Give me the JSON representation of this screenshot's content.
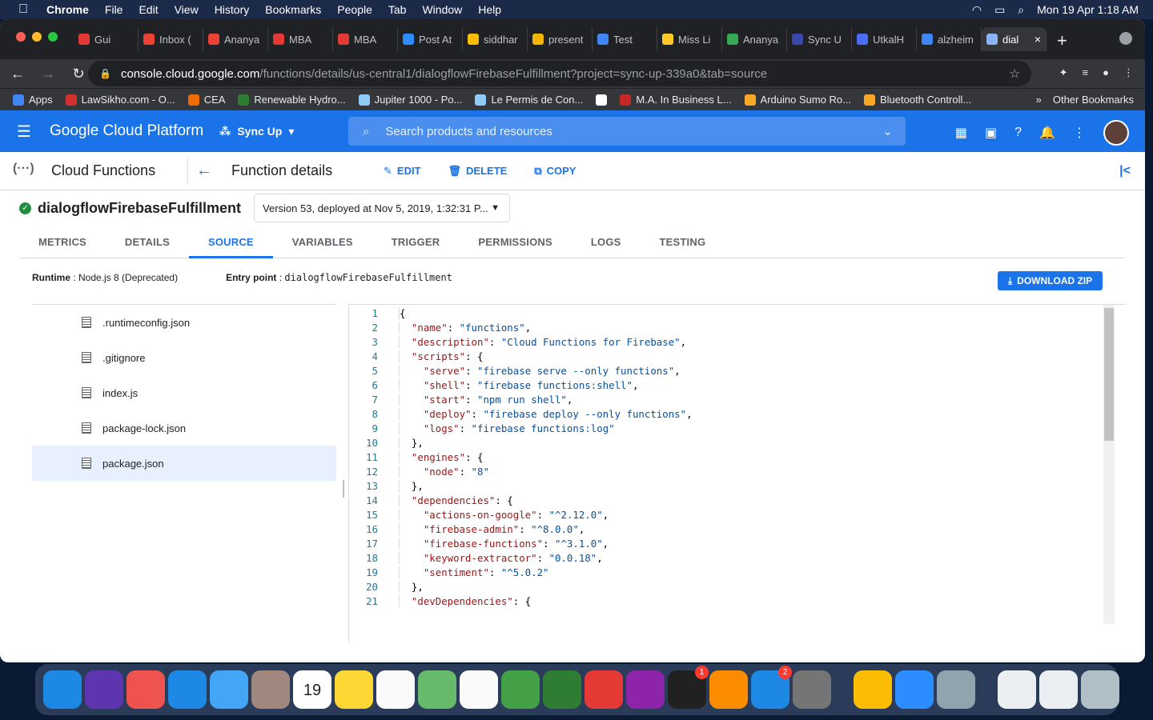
{
  "os": {
    "menubar": [
      "Chrome",
      "File",
      "Edit",
      "View",
      "History",
      "Bookmarks",
      "People",
      "Tab",
      "Window",
      "Help"
    ],
    "clock": "Mon 19 Apr  1:18 AM"
  },
  "browser": {
    "tabs": [
      {
        "label": "Gui",
        "color": "#e53935"
      },
      {
        "label": "Inbox (",
        "color": "#ea4335"
      },
      {
        "label": "Ananya",
        "color": "#ea4335"
      },
      {
        "label": "MBA",
        "color": "#e53935"
      },
      {
        "label": "MBA",
        "color": "#e53935"
      },
      {
        "label": "Post At",
        "color": "#2d8cff"
      },
      {
        "label": "siddhar",
        "color": "#fbbc04"
      },
      {
        "label": "present",
        "color": "#f4b400"
      },
      {
        "label": "Test",
        "color": "#4285f4"
      },
      {
        "label": "Miss Li",
        "color": "#ffca28"
      },
      {
        "label": "Ananya",
        "color": "#34a853"
      },
      {
        "label": "Sync U",
        "color": "#3949ab"
      },
      {
        "label": "UtkalH",
        "color": "#4a6cf7"
      },
      {
        "label": "alzheim",
        "color": "#4285f4"
      },
      {
        "label": "dial",
        "color": "#8ab4f8"
      }
    ],
    "url_host": "console.cloud.google.com",
    "url_path": "/functions/details/us-central1/dialogflowFirebaseFulfillment?project=sync-up-339a0&tab=source",
    "bookmarks": [
      {
        "label": "Apps",
        "color": "#4285f4"
      },
      {
        "label": "LawSikho.com - O...",
        "color": "#d32f2f"
      },
      {
        "label": "CEA",
        "color": "#ef6c00"
      },
      {
        "label": "Renewable Hydro...",
        "color": "#2e7d32"
      },
      {
        "label": "Jupiter 1000 - Po...",
        "color": "#90caf9"
      },
      {
        "label": "Le Permis de Con...",
        "color": "#90caf9"
      },
      {
        "label": "",
        "color": "#ffffff"
      },
      {
        "label": "M.A. In Business L...",
        "color": "#c62828"
      },
      {
        "label": "Arduino Sumo Ro...",
        "color": "#f9a825"
      },
      {
        "label": "Bluetooth Controll...",
        "color": "#f9a825"
      }
    ],
    "other_bookmarks": "Other Bookmarks"
  },
  "gcp": {
    "logo": "Google Cloud Platform",
    "project": "Sync Up",
    "search_placeholder": "Search products and resources",
    "section": "Cloud Functions",
    "page_title": "Function details",
    "actions": {
      "edit": "EDIT",
      "delete": "DELETE",
      "copy": "COPY"
    },
    "function_name": "dialogflowFirebaseFulfillment",
    "version": "Version 53, deployed at Nov 5, 2019, 1:32:31 P...",
    "tabs": [
      "METRICS",
      "DETAILS",
      "SOURCE",
      "VARIABLES",
      "TRIGGER",
      "PERMISSIONS",
      "LOGS",
      "TESTING"
    ],
    "runtime_label": "Runtime",
    "runtime_value": ": Node.js 8 (Deprecated)",
    "entry_label": "Entry point",
    "entry_sep": ": ",
    "entry_value": "dialogflowFirebaseFulfillment",
    "download": "DOWNLOAD ZIP",
    "files": [
      ".runtimeconfig.json",
      ".gitignore",
      "index.js",
      "package-lock.json",
      "package.json"
    ],
    "selected_file": "package.json"
  },
  "code_lines": [
    "{",
    "  \"name\": \"functions\",",
    "  \"description\": \"Cloud Functions for Firebase\",",
    "  \"scripts\": {",
    "    \"serve\": \"firebase serve --only functions\",",
    "    \"shell\": \"firebase functions:shell\",",
    "    \"start\": \"npm run shell\",",
    "    \"deploy\": \"firebase deploy --only functions\",",
    "    \"logs\": \"firebase functions:log\"",
    "  },",
    "  \"engines\": {",
    "    \"node\": \"8\"",
    "  },",
    "  \"dependencies\": {",
    "    \"actions-on-google\": \"^2.12.0\",",
    "    \"firebase-admin\": \"^8.0.0\",",
    "    \"firebase-functions\": \"^3.1.0\",",
    "    \"keyword-extractor\": \"0.0.18\",",
    "    \"sentiment\": \"^5.0.2\"",
    "  },",
    "  \"devDependencies\": {"
  ],
  "dock": [
    {
      "name": "finder-icon",
      "color": "#1e88e5"
    },
    {
      "name": "siri-icon",
      "color": "#5e35b1"
    },
    {
      "name": "launchpad-icon",
      "color": "#ef5350"
    },
    {
      "name": "safari-icon",
      "color": "#1e88e5"
    },
    {
      "name": "mail-icon",
      "color": "#42a5f5"
    },
    {
      "name": "contacts-icon",
      "color": "#a1887f"
    },
    {
      "name": "calendar-icon",
      "color": "#ffffff",
      "text": "19"
    },
    {
      "name": "notes-icon",
      "color": "#fdd835"
    },
    {
      "name": "reminders-icon",
      "color": "#fafafa"
    },
    {
      "name": "maps-icon",
      "color": "#66bb6a"
    },
    {
      "name": "photos-icon",
      "color": "#fafafa"
    },
    {
      "name": "messages-icon",
      "color": "#43a047"
    },
    {
      "name": "facetime-icon",
      "color": "#2e7d32"
    },
    {
      "name": "music-icon",
      "color": "#e53935"
    },
    {
      "name": "podcasts-icon",
      "color": "#8e24aa"
    },
    {
      "name": "tv-icon",
      "color": "#212121",
      "badge": "1"
    },
    {
      "name": "books-icon",
      "color": "#fb8c00"
    },
    {
      "name": "appstore-icon",
      "color": "#1e88e5",
      "badge": "2"
    },
    {
      "name": "settings-icon",
      "color": "#757575"
    },
    {
      "name": "chrome-icon",
      "color": "#fbbc04"
    },
    {
      "name": "zoom-icon",
      "color": "#2d8cff"
    },
    {
      "name": "quicktime-icon",
      "color": "#90a4ae"
    },
    {
      "name": "zip-file-icon",
      "color": "#eceff1"
    },
    {
      "name": "pdf-file-icon",
      "color": "#eceff1"
    },
    {
      "name": "trash-icon",
      "color": "#b0bec5"
    }
  ]
}
